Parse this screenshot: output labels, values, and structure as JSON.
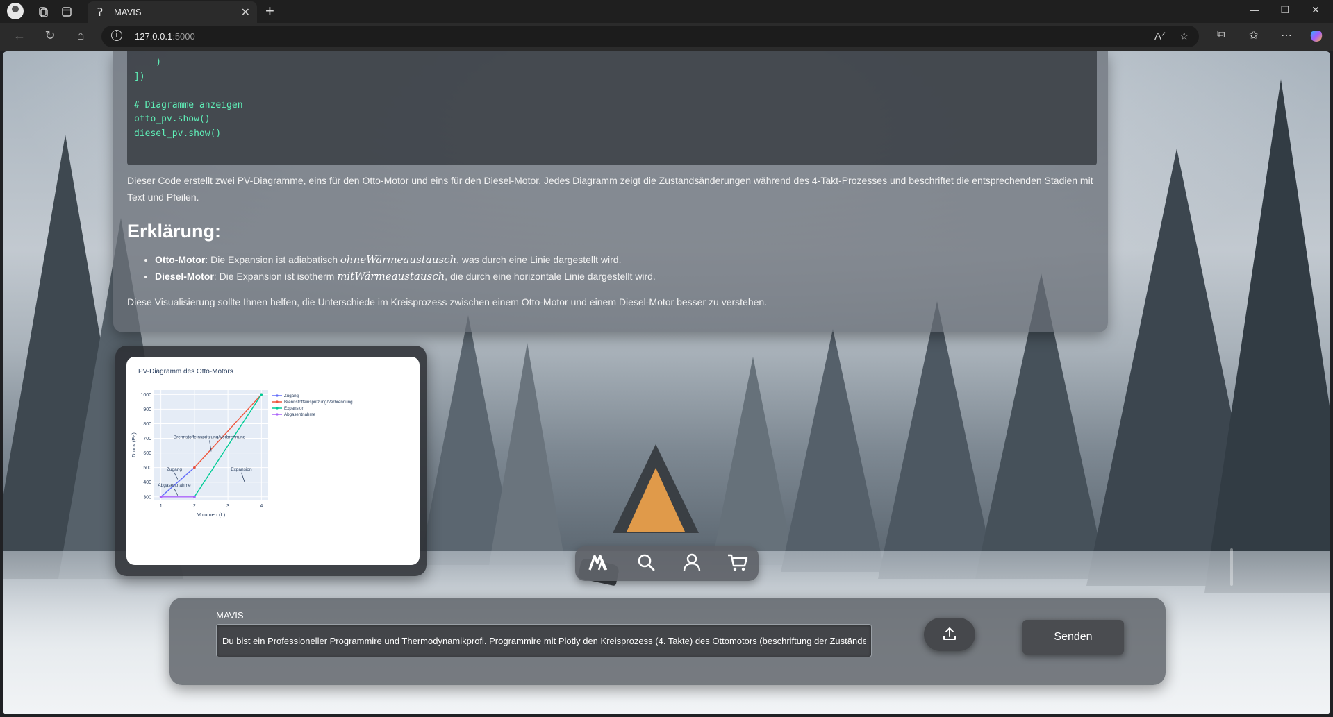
{
  "browser": {
    "tab_title": "MAVIS",
    "url_host": "127.0.0.1",
    "url_port": ":5000"
  },
  "message": {
    "code_lines": [
      "    )",
      "])",
      "",
      "# Diagramme anzeigen",
      "otto_pv.show()",
      "diesel_pv.show()"
    ],
    "paragraph_1": "Dieser Code erstellt zwei PV-Diagramme, eins für den Otto-Motor und eins für den Diesel-Motor. Jedes Diagramm zeigt die Zustandsänderungen während des 4-Takt-Prozesses und beschriftet die entsprechenden Stadien mit Text und Pfeilen.",
    "heading": "Erklärung:",
    "bullets": [
      {
        "term": "Otto-Motor",
        "pre": ": Die Expansion ist adiabatisch ",
        "math": "ohneWärmeaustausch",
        "post": ", was durch eine Linie dargestellt wird."
      },
      {
        "term": "Diesel-Motor",
        "pre": ": Die Expansion ist isotherm ",
        "math": "mitWärmeaustausch",
        "post": ", die durch eine horizontale Linie dargestellt wird."
      }
    ],
    "paragraph_2": "Diese Visualisierung sollte Ihnen helfen, die Unterschiede im Kreisprozess zwischen einem Otto-Motor und einem Diesel-Motor besser zu verstehen."
  },
  "chart_data": {
    "type": "line",
    "title": "PV-Diagramm des Otto-Motors",
    "xlabel": "Volumen (L)",
    "ylabel": "Druck (Pa)",
    "xlim": [
      0.8,
      4.2
    ],
    "ylim": [
      280,
      1030
    ],
    "xticks": [
      1,
      2,
      3,
      4
    ],
    "yticks": [
      300,
      400,
      500,
      600,
      700,
      800,
      900,
      1000
    ],
    "legend_position": "top-right",
    "series": [
      {
        "name": "Zugang",
        "color": "#636efa",
        "x": [
          1,
          2
        ],
        "y": [
          300,
          500
        ]
      },
      {
        "name": "Brennstoffeinspritzung/Verbrennung",
        "color": "#ef553b",
        "x": [
          2,
          4
        ],
        "y": [
          500,
          1000
        ]
      },
      {
        "name": "Expansion",
        "color": "#00cc96",
        "x": [
          4,
          2
        ],
        "y": [
          1000,
          300
        ]
      },
      {
        "name": "Abgasentnahme",
        "color": "#ab63fa",
        "x": [
          2,
          1
        ],
        "y": [
          300,
          300
        ]
      }
    ],
    "annotations": [
      {
        "text": "Brennstoffeinspritzung/Verbrennung",
        "x": 2.45,
        "y": 700,
        "ax": 2.5,
        "ay": 610
      },
      {
        "text": "Zugang",
        "x": 1.4,
        "y": 480,
        "ax": 1.5,
        "ay": 420
      },
      {
        "text": "Abgasentnahme",
        "x": 1.4,
        "y": 370,
        "ax": 1.5,
        "ay": 310
      },
      {
        "text": "Expansion",
        "x": 3.4,
        "y": 480,
        "ax": 3.5,
        "ay": 400
      }
    ]
  },
  "toolbar": {
    "icons": [
      "mavis-logo-icon",
      "search-icon",
      "user-icon",
      "cart-icon"
    ]
  },
  "input": {
    "label": "MAVIS",
    "value": "Du bist ein Professioneller Programmire und Thermodynamikprofi. Programmire mit Plotly den Kreisprozess (4. Takte) des Ottomotors (beschriftung der Zustände mit Text und Pfeilen)",
    "send_label": "Senden"
  }
}
